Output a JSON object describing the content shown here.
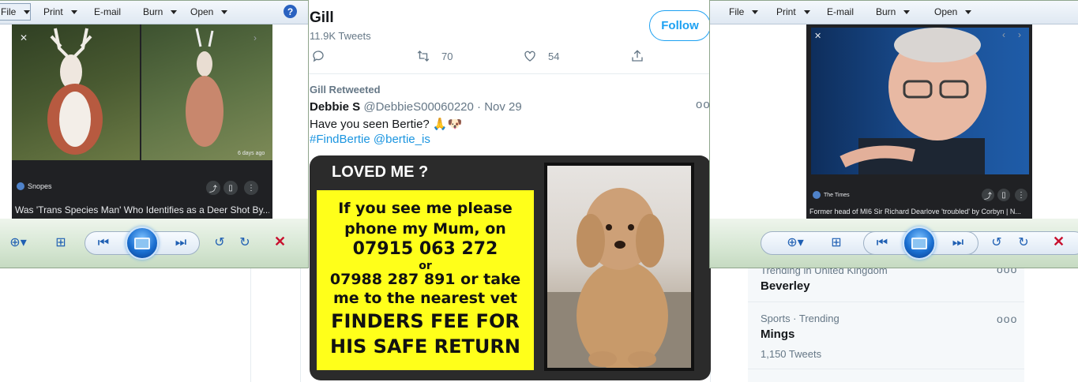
{
  "twitter": {
    "profile_name": "Gill",
    "tweet_count": "11.9K Tweets",
    "follow_label": "Follow",
    "retweet_count": "70",
    "like_count": "54",
    "retweeted_label": "Gill Retweeted",
    "author_name": "Debbie S",
    "author_handle": "@DebbieS00060220",
    "date": "· Nov 29",
    "more": "ooo",
    "tweet_text": "Have you seen Bertie? 🙏🐶",
    "hashtag": "#FindBertie",
    "mention": "@bertie_is"
  },
  "poster": {
    "title": "LOVED ME ?",
    "lines": [
      "If you see me please",
      "phone my Mum, on",
      "07915 063 272",
      "or",
      "07988 287 891 or take",
      "me to the nearest vet",
      "FINDERS FEE FOR",
      "HIS SAFE RETURN"
    ]
  },
  "trends": [
    {
      "meta": "Trending in United Kingdom",
      "name": "Beverley",
      "count": "",
      "more": "ooo"
    },
    {
      "meta": "Sports · Trending",
      "name": "Mings",
      "count": "1,150 Tweets",
      "more": "ooo"
    }
  ],
  "viewer_left": {
    "menu": {
      "file": "File",
      "print": "Print",
      "email": "E-mail",
      "burn": "Burn",
      "open": "Open",
      "help": "?"
    },
    "card": {
      "source": "Snopes",
      "time": "6 days ago",
      "caption": "Was 'Trans Species Man' Who Identifies as a Deer Shot By..."
    }
  },
  "viewer_right": {
    "menu": {
      "file": "File",
      "print": "Print",
      "email": "E-mail",
      "burn": "Burn",
      "open": "Open"
    },
    "card": {
      "source": "The Times",
      "caption": "Former head of MI6 Sir Richard Dearlove 'troubled' by Corbyn | N..."
    }
  },
  "colors": {
    "twitter_blue": "#1da1f2",
    "poster_yellow": "#ffff1a",
    "close_red": "#c8102e"
  }
}
